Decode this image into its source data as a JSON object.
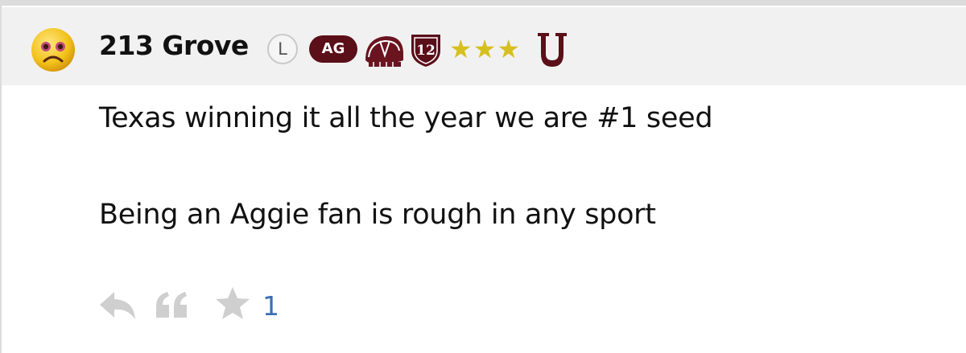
{
  "post": {
    "username": "213 Grove",
    "badges": {
      "level_label": "L",
      "group_label": "AG",
      "number_label": "12",
      "stars": "★★★"
    },
    "lines": [
      "Texas winning it all the year we are #1 seed",
      "Being an Aggie fan is rough in any sport"
    ],
    "actions": {
      "like_count": "1"
    }
  },
  "colors": {
    "header_bg": "#f1f1f1",
    "maroon": "#5a0f19",
    "star_gold": "#d6bf22",
    "action_grey": "#cfcfcf",
    "link_blue": "#3a6fb5"
  },
  "icons": [
    "sad-face-avatar",
    "helmet-badge-icon",
    "shield-badge-icon",
    "u-logo-icon",
    "reply-icon",
    "quote-icon",
    "star-icon"
  ]
}
